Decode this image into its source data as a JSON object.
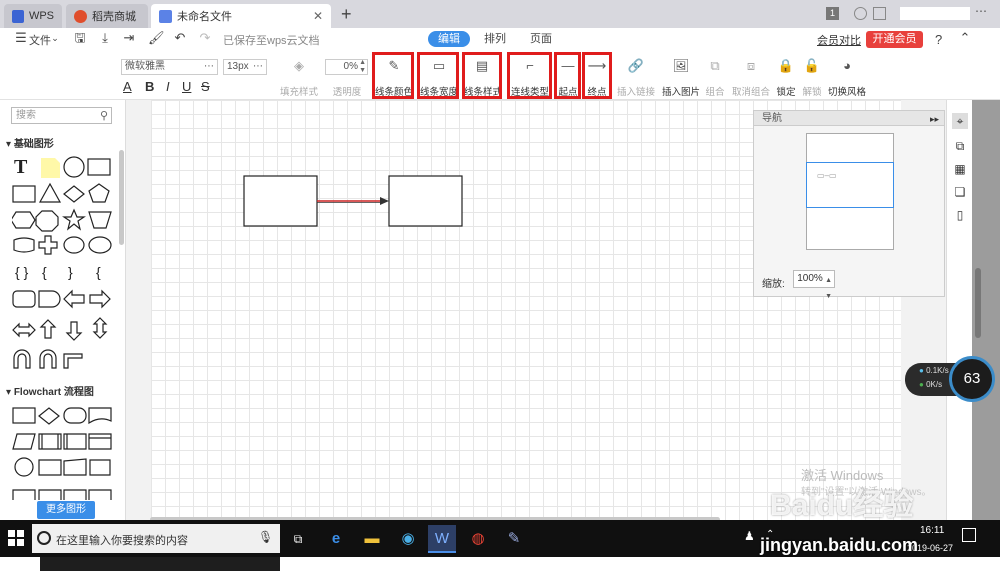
{
  "browser": {
    "tabs": [
      {
        "label": "WPS"
      },
      {
        "label": "稻壳商城"
      },
      {
        "label": "未命名文件"
      }
    ],
    "badge": "1"
  },
  "menu": {
    "file_label": "文件",
    "saved_status": "已保存至wps云文档",
    "content_tabs": [
      "编辑",
      "排列",
      "页面"
    ],
    "member_compare": "会员对比",
    "vip_button": "开通会员",
    "help": "?"
  },
  "toolbar": {
    "font_name": "微软雅黑",
    "font_size": "13px",
    "opacity_value": "0%",
    "format_buttons": [
      "A",
      "B",
      "I",
      "U",
      "S"
    ],
    "tools": [
      {
        "label": "填充样式",
        "icon": "fill-bucket-icon"
      },
      {
        "label": "透明度",
        "icon": ""
      },
      {
        "label": "线条颜色",
        "icon": "pen-icon"
      },
      {
        "label": "线条宽度",
        "icon": "line-width-icon"
      },
      {
        "label": "线条样式",
        "icon": "line-style-icon"
      },
      {
        "label": "连线类型",
        "icon": "connector-icon"
      },
      {
        "label": "起点",
        "icon": "line-start-icon"
      },
      {
        "label": "终点",
        "icon": "arrow-end-icon"
      },
      {
        "label": "插入链接",
        "icon": "link-icon"
      },
      {
        "label": "插入图片",
        "icon": "image-icon"
      },
      {
        "label": "组合",
        "icon": "group-icon"
      },
      {
        "label": "取消组合",
        "icon": "ungroup-icon"
      },
      {
        "label": "锁定",
        "icon": "lock-icon"
      },
      {
        "label": "解锁",
        "icon": "unlock-icon"
      },
      {
        "label": "切换风格",
        "icon": "style-icon"
      }
    ]
  },
  "left_panel": {
    "search_placeholder": "搜索",
    "section_basic": "基础图形",
    "section_flowchart": "Flowchart 流程图",
    "more_shapes": "更多图形"
  },
  "navigator": {
    "title": "导航",
    "zoom_label": "缩放:",
    "zoom_value": "100%"
  },
  "speed_widget": {
    "up": "0.1K/s",
    "down": "0K/s",
    "gauge": "63"
  },
  "watermark": {
    "activate": "激活 Windows",
    "activate_sub": "转到\"设置\"以激活 Windows。",
    "baidu": "Baidu经验",
    "site": "jingyan.baidu.com"
  },
  "taskbar": {
    "search_text": "在这里输入你要搜索的内容",
    "time": "16:11",
    "date": "2019-06-27"
  },
  "colors": {
    "accent": "#3a8ee8",
    "vip": "#e8403c",
    "highlight": "#e01c1c"
  }
}
